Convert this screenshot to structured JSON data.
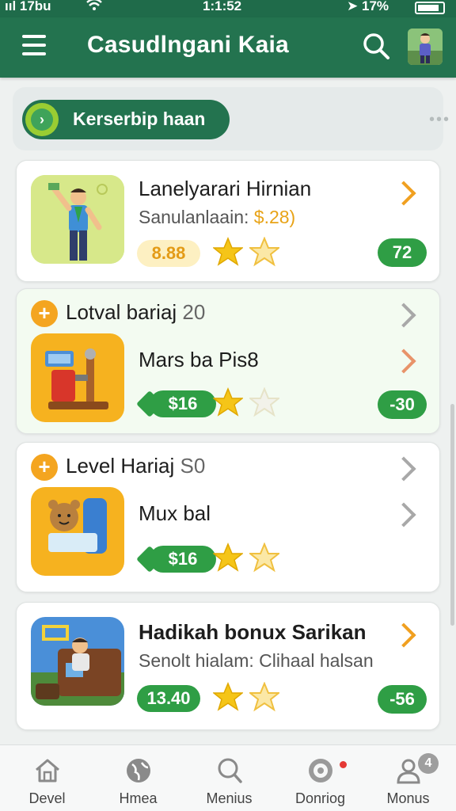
{
  "status_bar": {
    "signal": "ııl 17bu",
    "time": "1:1:52",
    "battery_text": "17%"
  },
  "app_bar": {
    "title": "Casudlngani Kaia"
  },
  "filter_chip": {
    "label": "Kerserbip haan",
    "more": "•••"
  },
  "cards": [
    {
      "title": "Lanelyarari Hirnian",
      "subtitle_prefix": "Sanulanlaain: ",
      "subtitle_price": "$.28)",
      "price": "8.88",
      "score": "72",
      "stars_filled": 1,
      "stars_outline": 1
    },
    {
      "header_prefix": "Lotval bariaj ",
      "header_num": "20",
      "title": "Mars ba Pis8",
      "price": "$16",
      "score": "-30",
      "stars_filled": 1,
      "stars_outline": 1
    },
    {
      "header_prefix": "Level Hariaj ",
      "header_num": "S0",
      "title": "Mux bal",
      "price": "$16",
      "score": "",
      "stars_filled": 1,
      "stars_outline": 1
    },
    {
      "title": "Hadikah bonux Sarikan",
      "subtitle": "Senolt hialam: Clihaal halsan",
      "price": "13.40",
      "score": "-56",
      "stars_filled": 1,
      "stars_outline": 1
    }
  ],
  "bottom_nav": [
    {
      "label": "Devel",
      "icon": "home-icon"
    },
    {
      "label": "Hmea",
      "icon": "globe-icon"
    },
    {
      "label": "Menius",
      "icon": "search-icon"
    },
    {
      "label": "Donriog",
      "icon": "chat-icon"
    },
    {
      "label": "Monus",
      "icon": "user-icon",
      "badge": "4"
    }
  ],
  "colors": {
    "primary": "#23734f",
    "accent_green": "#2f9e45",
    "accent_orange": "#f4a520",
    "star": "#f5c518"
  }
}
